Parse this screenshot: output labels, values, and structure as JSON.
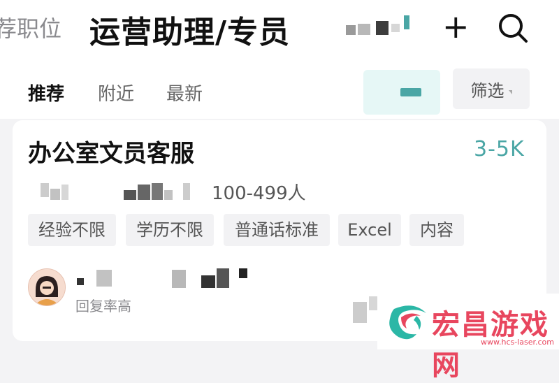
{
  "header": {
    "prev_tab": "荐职位",
    "title": "运营助理/专员"
  },
  "filters": {
    "tabs": [
      "推荐",
      "附近",
      "最新"
    ],
    "screen_label": "筛选"
  },
  "job": {
    "title": "办公室文员客服",
    "salary": "3-5K",
    "company_size": "100-499人",
    "tags": [
      "经验不限",
      "学历不限",
      "普通话标准",
      "Excel",
      "内容"
    ]
  },
  "recruiter": {
    "reply_status": "回复率高"
  },
  "watermark": {
    "name": "宏昌游戏网",
    "url": "www.hcs-laser.com"
  },
  "colors": {
    "accent": "#4aa6a5",
    "watermark": "#e8465e"
  },
  "icons": {
    "add": "plus-icon",
    "search": "search-icon",
    "dismiss": "close-icon"
  }
}
